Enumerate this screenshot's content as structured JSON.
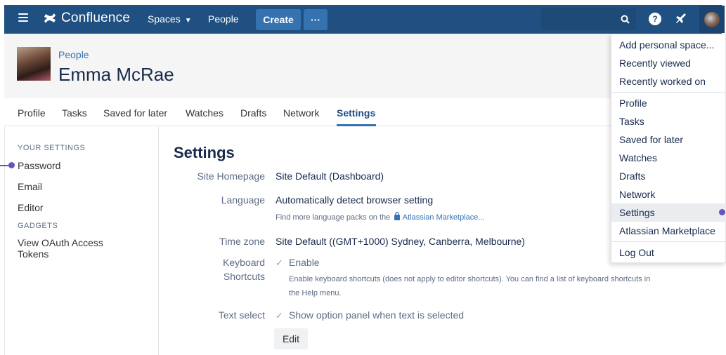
{
  "topnav": {
    "brand": "Confluence",
    "spaces": "Spaces",
    "people": "People",
    "create": "Create",
    "more": "···",
    "help_glyph": "?",
    "colors": {
      "nav_bg": "#205081",
      "button_bg": "#3572b0"
    }
  },
  "profile": {
    "breadcrumb": "People",
    "name": "Emma McRae"
  },
  "tabs": [
    {
      "label": "Profile"
    },
    {
      "label": "Tasks"
    },
    {
      "label": "Saved for later"
    },
    {
      "label": "Watches"
    },
    {
      "label": "Drafts"
    },
    {
      "label": "Network"
    },
    {
      "label": "Settings",
      "active": true
    }
  ],
  "sidebar": {
    "your_settings": "YOUR SETTINGS",
    "password": "Password",
    "email": "Email",
    "editor": "Editor",
    "gadgets": "GADGETS",
    "oauth_line1": "View OAuth Access",
    "oauth_line2": "Tokens"
  },
  "settings": {
    "title": "Settings",
    "site_homepage_label": "Site Homepage",
    "site_homepage_value": "Site Default (Dashboard)",
    "language_label": "Language",
    "language_value": "Automatically detect browser setting",
    "language_hint_prefix": "Find more language packs on the",
    "language_hint_link": "Atlassian Marketplace",
    "language_hint_suffix": "...",
    "timezone_label": "Time zone",
    "timezone_value": "Site Default ((GMT+1000) Sydney, Canberra, Melbourne)",
    "keyboard_label_1": "Keyboard",
    "keyboard_label_2": "Shortcuts",
    "keyboard_value": "Enable",
    "keyboard_hint_1": "Enable keyboard shortcuts (does not apply to editor shortcuts). You can find a list of keyboard shortcuts in",
    "keyboard_hint_2": "the Help menu.",
    "textselect_label": "Text select",
    "textselect_value": "Show option panel when text is selected",
    "edit": "Edit",
    "check_glyph": "✓"
  },
  "dropdown": {
    "items": [
      "Add personal space...",
      "Recently viewed",
      "Recently worked on",
      "Profile",
      "Tasks",
      "Saved for later",
      "Watches",
      "Drafts",
      "Network",
      "Settings",
      "Atlassian Marketplace",
      "Log Out"
    ],
    "highlighted": "Settings",
    "highlight_color": "#ebecf0"
  },
  "annotation_color": "#6554c0"
}
